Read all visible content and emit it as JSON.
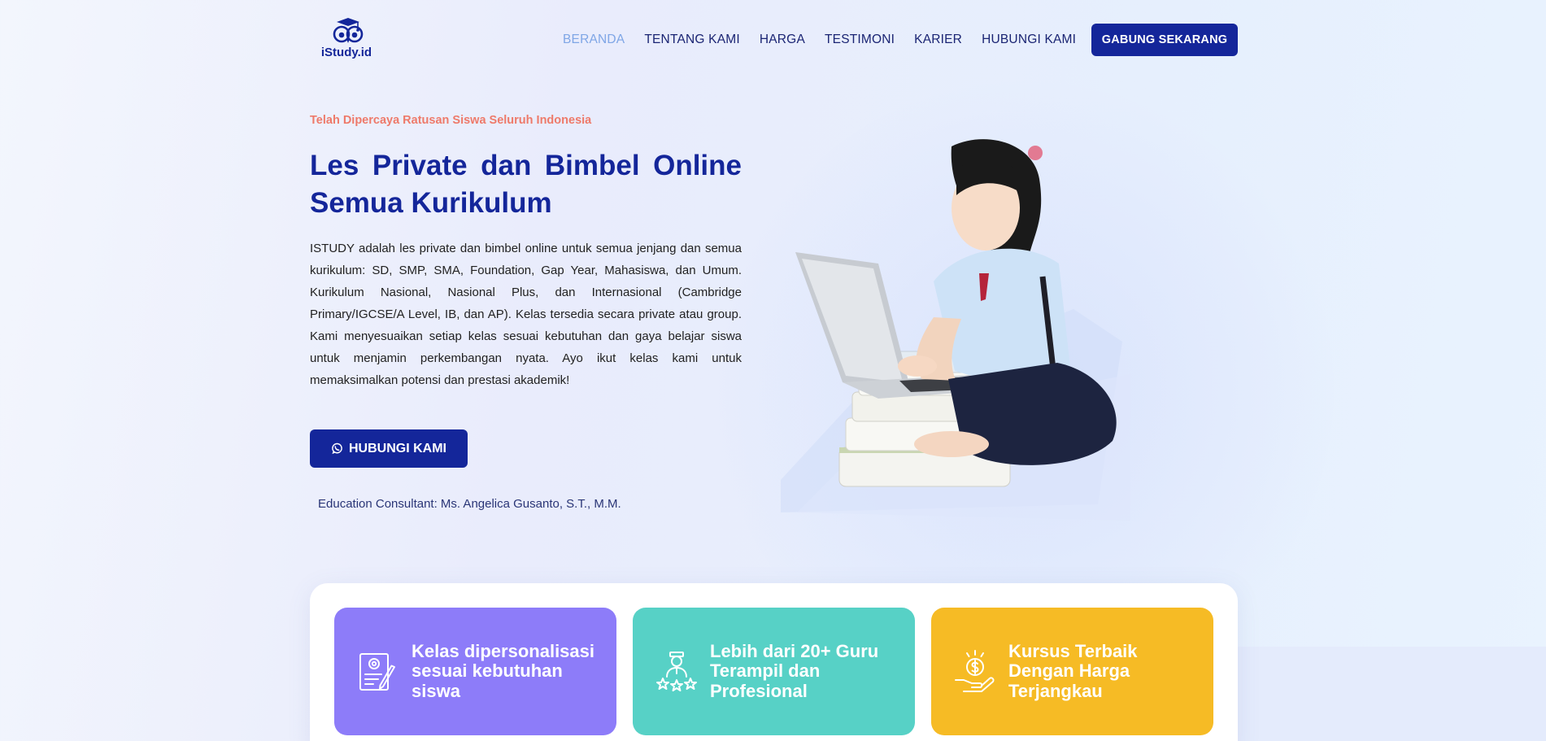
{
  "brand": {
    "name": "iStudy.id"
  },
  "nav": {
    "items": [
      {
        "label": "BERANDA",
        "active": true
      },
      {
        "label": "TENTANG KAMI"
      },
      {
        "label": "HARGA"
      },
      {
        "label": "TESTIMONI"
      },
      {
        "label": "KARIER"
      },
      {
        "label": "HUBUNGI KAMI"
      }
    ],
    "cta": "GABUNG SEKARANG"
  },
  "hero": {
    "tagline": "Telah Dipercaya Ratusan Siswa Seluruh Indonesia",
    "title": "Les Private dan Bimbel Online Semua Kurikulum",
    "description": "ISTUDY adalah les private dan bimbel online untuk semua jenjang dan semua kurikulum: SD, SMP, SMA, Foundation, Gap Year, Mahasiswa, dan Umum. Kurikulum Nasional, Nasional Plus, dan Internasional (Cambridge Primary/IGCSE/A Level, IB, dan AP). Kelas tersedia secara private atau group. Kami menyesuaikan setiap kelas sesuai kebutuhan dan gaya belajar siswa untuk menjamin perkembangan nyata. Ayo ikut kelas kami untuk memaksimalkan potensi dan prestasi akademik!",
    "cta": "HUBUNGI KAMI",
    "cta_icon": "whatsapp-icon",
    "consultant": "Education Consultant: Ms. Angelica Gusanto, S.T., M.M."
  },
  "features": [
    {
      "text": "Kelas dipersonalisasi sesuai kebutuhan siswa",
      "icon": "personalized-class-icon",
      "color": "#8d7cf9"
    },
    {
      "text": "Lebih dari 20+ Guru Terampil dan Profesional",
      "icon": "teacher-icon",
      "color": "#57d1c6"
    },
    {
      "text": "Kursus Terbaik Dengan Harga Terjangkau",
      "icon": "price-coin-icon",
      "color": "#f6bb25"
    }
  ],
  "colors": {
    "primary": "#14269a",
    "accent": "#ee7a6a",
    "nav_active": "#7fa6e6"
  }
}
